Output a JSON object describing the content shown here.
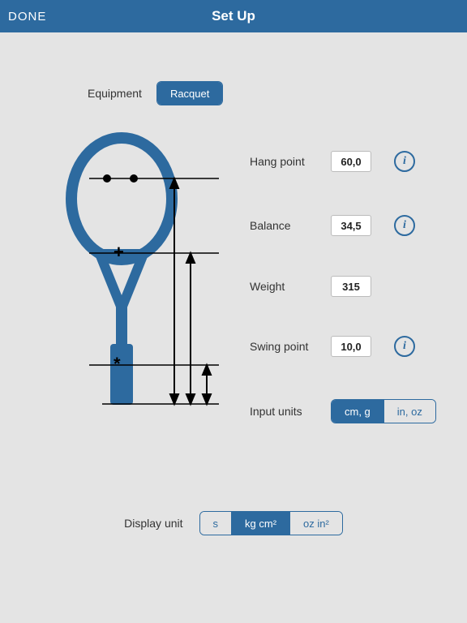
{
  "header": {
    "done": "DONE",
    "title": "Set Up"
  },
  "equipment": {
    "label": "Equipment",
    "options": [
      "Racquet"
    ],
    "selected": 0
  },
  "fields": {
    "hang": {
      "label": "Hang point",
      "value": "60,0",
      "info": true
    },
    "balance": {
      "label": "Balance",
      "value": "34,5",
      "info": true
    },
    "weight": {
      "label": "Weight",
      "value": "315",
      "info": false
    },
    "swing": {
      "label": "Swing point",
      "value": "10,0",
      "info": true
    }
  },
  "inputUnits": {
    "label": "Input units",
    "options": [
      "cm, g",
      "in, oz"
    ],
    "selected": 0
  },
  "displayUnits": {
    "label": "Display unit",
    "options": [
      "s",
      "kg cm²",
      "oz in²"
    ],
    "selected": 1
  },
  "infoGlyph": "i"
}
